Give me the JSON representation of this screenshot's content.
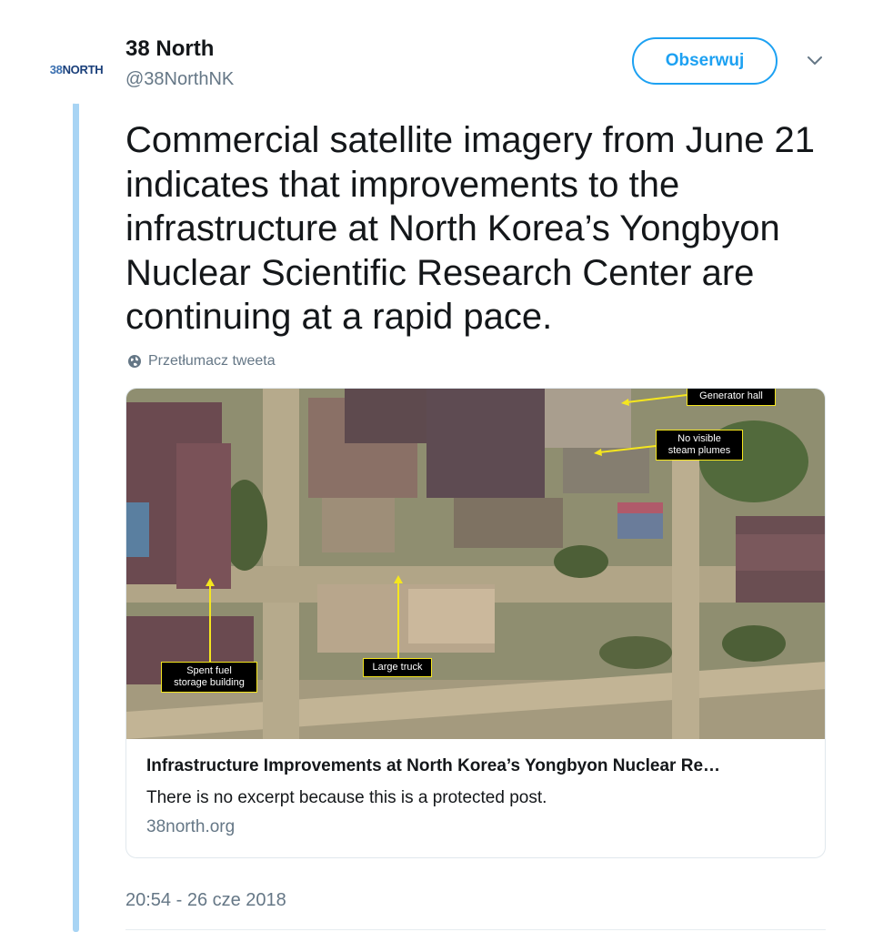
{
  "account": {
    "avatar_text_number": "38",
    "avatar_text_word": "NORTH",
    "name": "38 North",
    "handle": "@38NorthNK"
  },
  "actions": {
    "follow_label": "Obserwuj",
    "menu_icon": "chevron-down-icon"
  },
  "tweet": {
    "text": "Commercial satellite imagery from June 21 indicates that improvements to the infrastructure at North Korea’s Yongbyon Nuclear Scientific Research Center are continuing at a rapid pace.",
    "translate_label": "Przetłumacz tweeta",
    "translate_icon": "globe-icon",
    "timestamp": "20:54 - 26 cze 2018"
  },
  "card": {
    "image_labels": {
      "generator_hall": "Generator hall",
      "no_steam_line1": "No visible",
      "no_steam_line2": "steam plumes",
      "spent_fuel_line1": "Spent fuel",
      "spent_fuel_line2": "storage building",
      "large_truck": "Large truck"
    },
    "title": "Infrastructure Improvements at North Korea’s Yongbyon Nuclear Re…",
    "excerpt": "There is no excerpt because this is a protected post.",
    "domain": "38north.org"
  },
  "colors": {
    "accent": "#1da1f2",
    "thread_line": "#a8d4f4",
    "label_border": "#f5e61e",
    "secondary_text": "#657786"
  }
}
